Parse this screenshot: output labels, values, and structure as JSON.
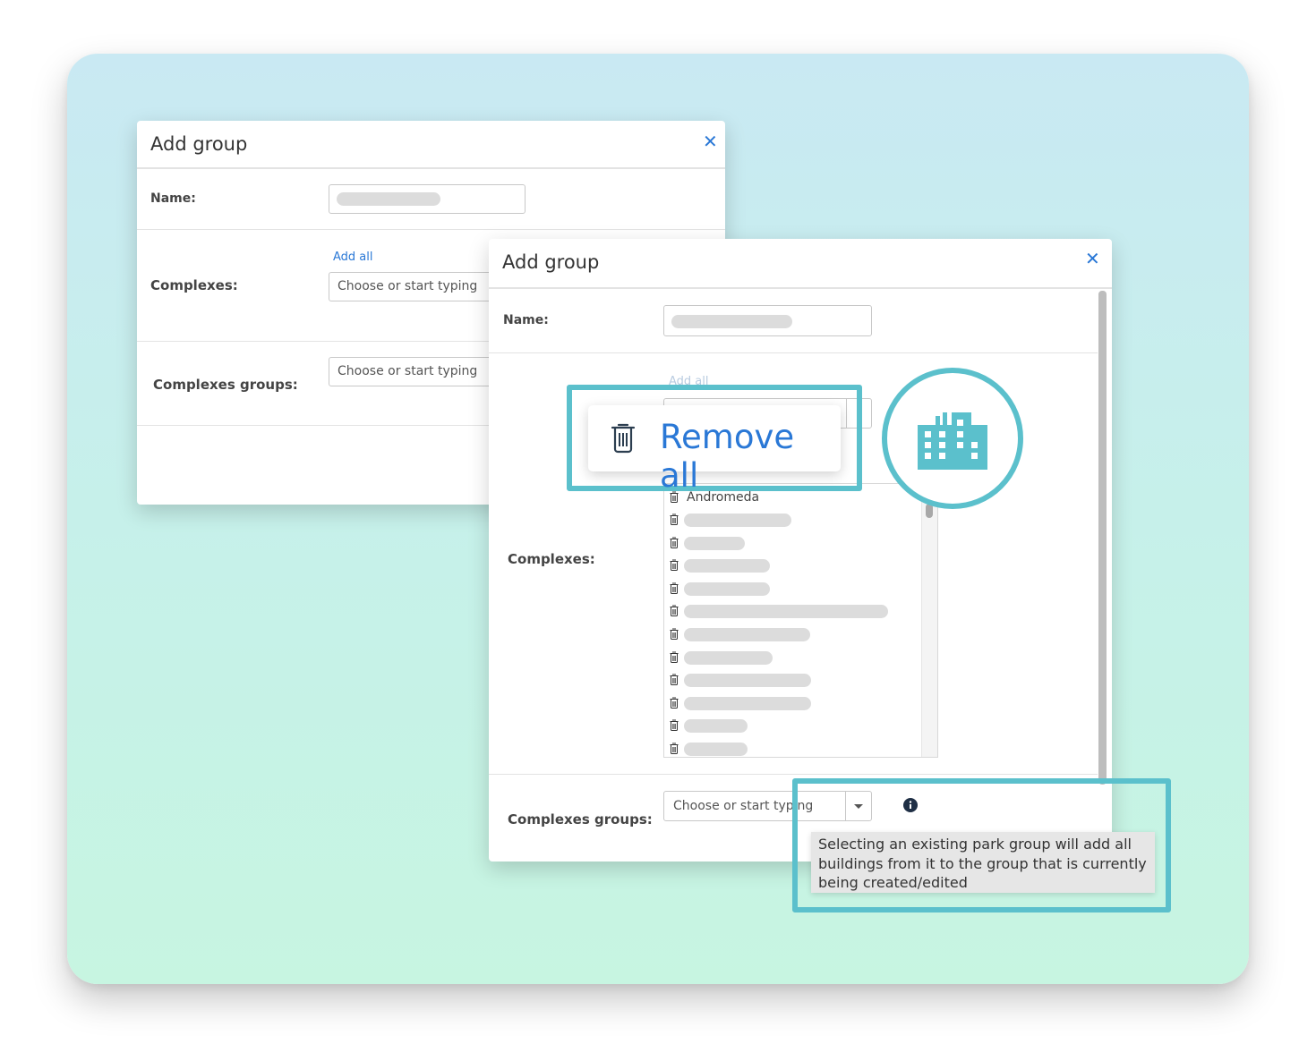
{
  "back_dialog": {
    "title": "Add group",
    "close_symbol": "✕",
    "name_label": "Name:",
    "add_all_link": "Add all",
    "complexes_label": "Complexes:",
    "complexes_placeholder": "Choose or start typing",
    "complexes_groups_label": "Complexes groups:",
    "complexes_groups_placeholder": "Choose or start typing"
  },
  "front_dialog": {
    "title": "Add group",
    "close_symbol": "✕",
    "name_label": "Name:",
    "add_all_link": "Add all",
    "complexes_label": "Complexes:",
    "complexes_list_first": "Andromeda",
    "complexes_groups_label": "Complexes groups:",
    "complexes_groups_placeholder": "Choose or start typing"
  },
  "remove_all_callout": {
    "label": "Remove all",
    "icon": "trash-icon"
  },
  "building_badge": {
    "icon": "building-icon"
  },
  "tooltip": {
    "text": "Selecting an existing park group will add all buildings from it to the group that is currently being created/edited",
    "icon": "info-icon"
  },
  "colors": {
    "accent": "#5bc0cc",
    "link": "#2a78d6",
    "background_top": "#c9e9f3",
    "background_bottom": "#c7f5e1"
  }
}
